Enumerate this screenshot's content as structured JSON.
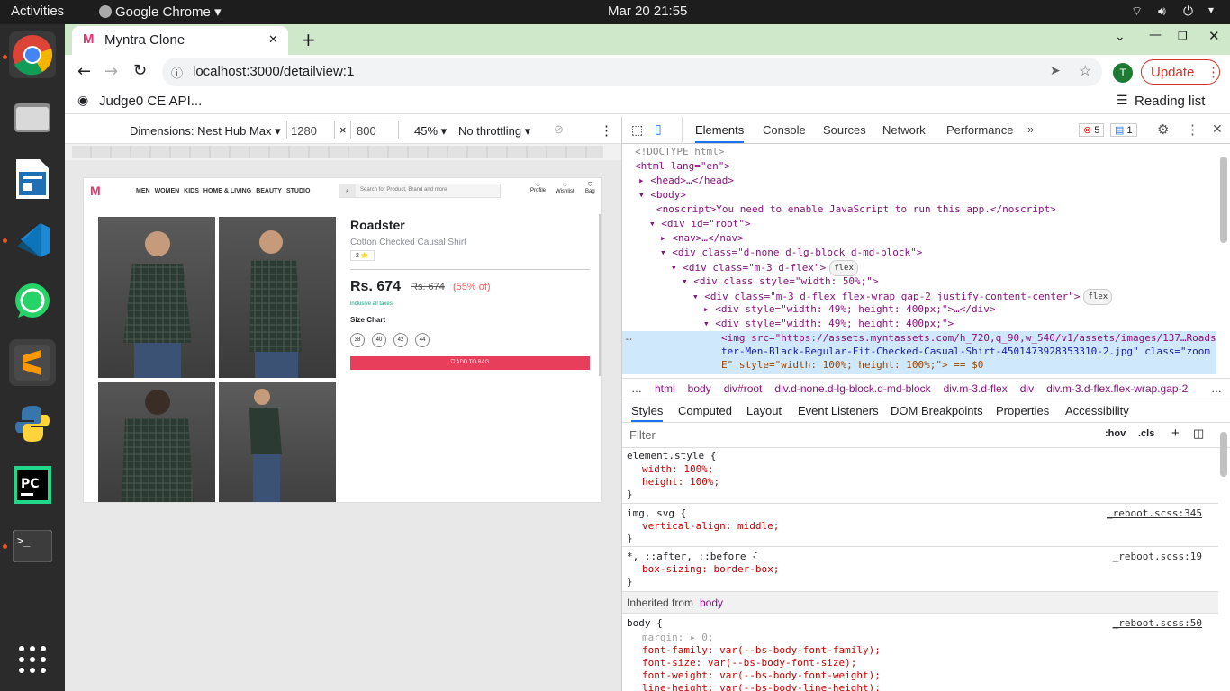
{
  "topbar": {
    "activities": "Activities",
    "app": "Google Chrome",
    "clock": "Mar 20  21:55"
  },
  "dock": {
    "items": [
      "chrome-icon",
      "files-icon",
      "writer-icon",
      "vscode-icon",
      "whatsapp-icon",
      "sublime-icon",
      "python-icon",
      "pycharm-icon",
      "terminal-icon",
      "apps-grid-icon"
    ]
  },
  "browser": {
    "tab_title": "Myntra Clone",
    "url": "localhost:3000/detailview:1",
    "update_label": "Update",
    "avatar": "T",
    "bookmark": "Judge0 CE API...",
    "reading_list": "Reading list"
  },
  "devicebar": {
    "device": "Dimensions: Nest Hub Max",
    "width": "1280",
    "height": "800",
    "zoom": "45%",
    "throttle": "No throttling"
  },
  "site": {
    "nav": [
      "MEN",
      "WOMEN",
      "KIDS",
      "HOME & LIVING",
      "BEAUTY",
      "STUDIO"
    ],
    "search_placeholder": "Search for Product, Brand and more",
    "icons": [
      "Profile",
      "Wishlist",
      "Bag"
    ],
    "brand": "Roadster",
    "product": "Cotton Checked Causal Shirt",
    "rating": "2 ⭐",
    "price": "Rs. 674",
    "mrp": "Rs. 674",
    "discount": "(55% of)",
    "taxes": "inclusive all taxes",
    "size_chart": "Size Chart",
    "sizes": [
      "38",
      "40",
      "42",
      "44"
    ],
    "cta": "ADD TO BAG",
    "accent": "#e83e5c"
  },
  "devtools": {
    "tabs": [
      "Elements",
      "Console",
      "Sources",
      "Network",
      "Performance"
    ],
    "errors": "5",
    "messages": "1",
    "dom": [
      "<!DOCTYPE html>",
      "<html lang=\"en\">",
      "<head>…</head>",
      "<body>",
      "<noscript>You need to enable JavaScript to run this app.</noscript>",
      "<div id=\"root\">",
      "<nav>…</nav>",
      "<div class=\"d-none d-lg-block d-md-block\">",
      "<div class=\"m-3 d-flex\">",
      "<div class style=\"width: 50%;\">",
      "<div class=\"m-3 d-flex flex-wrap gap-2 justify-content-center\">",
      "<div style=\"width: 49%; height: 400px;\">…</div>",
      "<div style=\"width: 49%; height: 400px;\">",
      "<img src=\"https://assets.myntassets.com/h_720,q_90,w_540/v1/assets/images/137…Roads",
      "ter-Men-Black-Regular-Fit-Checked-Casual-Shirt-4501473928353310-2.jpg\" class=\"zoom",
      "E\" style=\"width: 100%; height: 100%;\"> == $0"
    ],
    "pill_flex": "flex",
    "crumbs": [
      "html",
      "body",
      "div#root",
      "div.d-none.d-lg-block.d-md-block",
      "div.m-3.d-flex",
      "div",
      "div.m-3.d-flex.flex-wrap.gap-2"
    ],
    "subtabs": [
      "Styles",
      "Computed",
      "Layout",
      "Event Listeners",
      "DOM Breakpoints",
      "Properties",
      "Accessibility"
    ],
    "filter": "Filter",
    "hov": ":hov",
    "cls": ".cls",
    "rules": [
      {
        "sel": "element.style {",
        "props": [
          "width: 100%;",
          "height: 100%;"
        ],
        "src": ""
      },
      {
        "sel": "img, svg {",
        "props": [
          "vertical-align: middle;"
        ],
        "src": "_reboot.scss:345"
      },
      {
        "sel": "*, ::after, ::before {",
        "props": [
          "box-sizing: border-box;"
        ],
        "src": "_reboot.scss:19"
      }
    ],
    "inherited_label": "Inherited from",
    "inherited_from": "body",
    "body_rule": {
      "sel": "body {",
      "src": "_reboot.scss:50",
      "props": [
        "margin: ▸ 0;",
        "font-family: var(--bs-body-font-family);",
        "font-size: var(--bs-body-font-size);",
        "font-weight: var(--bs-body-font-weight);",
        "line-height: var(--bs-body-line-height);"
      ]
    }
  }
}
